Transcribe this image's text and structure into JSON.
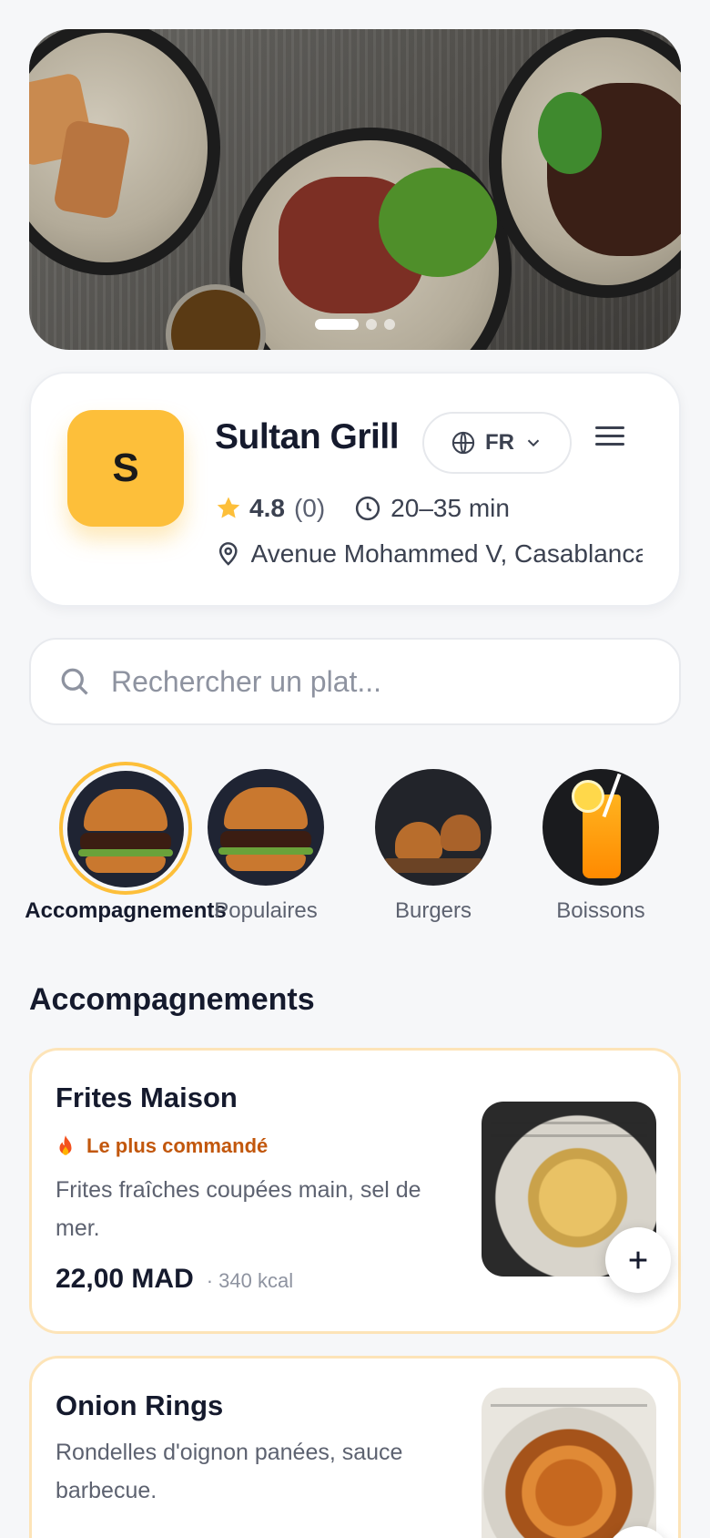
{
  "hero": {
    "slides_count": 3,
    "active_slide": 1
  },
  "restaurant": {
    "logo_letter": "S",
    "name": "Sultan Grill",
    "language": "FR",
    "rating": "4.8",
    "review_count": "(0)",
    "delivery_time": "20–35 min",
    "address": "Avenue Mohammed V, Casablanca"
  },
  "search": {
    "placeholder": "Rechercher un plat..."
  },
  "categories": [
    {
      "label": "Accompagnements",
      "active": true
    },
    {
      "label": "Populaires",
      "active": false
    },
    {
      "label": "Burgers",
      "active": false
    },
    {
      "label": "Boissons",
      "active": false
    }
  ],
  "section": {
    "title": "Accompagnements"
  },
  "products": [
    {
      "name": "Frites Maison",
      "badge": "Le plus commandé",
      "description": "Frites fraîches coupées main, sel de mer.",
      "price": "22,00 MAD",
      "kcal": "· 340 kcal"
    },
    {
      "name": "Onion Rings",
      "description": "Rondelles d'oignon panées, sauce barbecue."
    }
  ],
  "colors": {
    "accent": "#fdbf3a",
    "badge_text": "#c2570c",
    "card_border": "#fde4b8",
    "background": "#f6f7f9"
  }
}
